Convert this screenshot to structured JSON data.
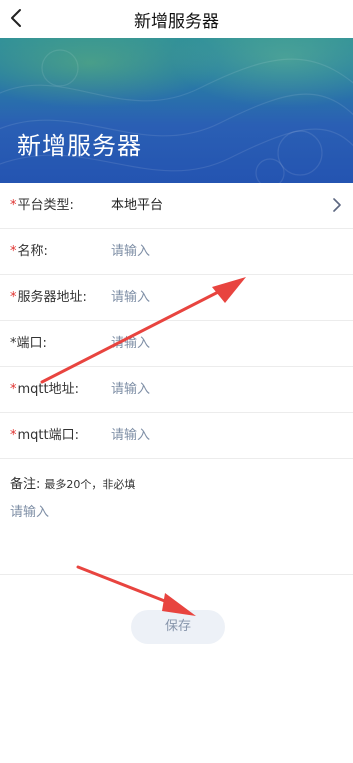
{
  "header": {
    "title": "新增服务器",
    "back_icon": "chevron-left-icon"
  },
  "banner": {
    "heading": "新增服务器"
  },
  "form": {
    "platform": {
      "required_mark": "*",
      "label": "平台类型:",
      "value": "本地平台",
      "icon": "chevron-right-icon"
    },
    "name": {
      "required_mark": "*",
      "label": "名称:",
      "placeholder": "请输入"
    },
    "address": {
      "required_mark": "*",
      "label": "服务器地址:",
      "placeholder": "请输入"
    },
    "port": {
      "required_mark": "*",
      "label": "端口:",
      "placeholder": "请输入"
    },
    "mqtt_address": {
      "required_mark": "*",
      "label": "mqtt地址:",
      "placeholder": "请输入"
    },
    "mqtt_port": {
      "required_mark": "*",
      "label": "mqtt端口:",
      "placeholder": "请输入"
    },
    "remark": {
      "label": "备注:",
      "hint": "最多20个，非必填",
      "placeholder": "请输入"
    }
  },
  "save_label": "保存",
  "colors": {
    "required": "#e0322f",
    "annotation_arrow": "#e8443f",
    "placeholder": "#7f8fa6"
  }
}
